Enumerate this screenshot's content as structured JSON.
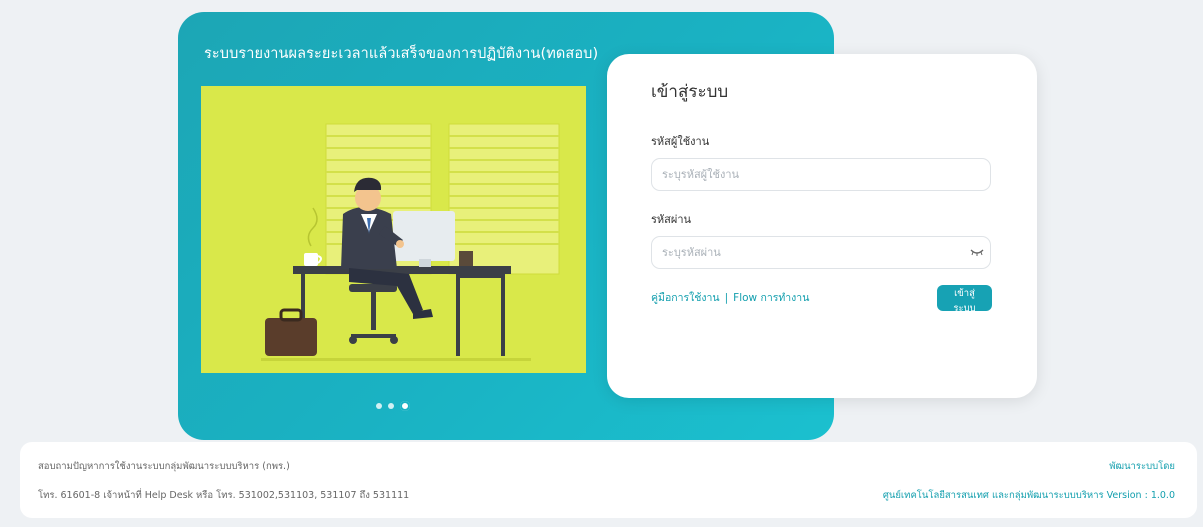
{
  "hero": {
    "title": "ระบบรายงานผลระยะเวลาแล้วเสร็จของการปฏิบัติงาน(ทดสอบ)",
    "carousel": {
      "slides": 3,
      "active_index": 3
    }
  },
  "login": {
    "title": "เข้าสู่ระบบ",
    "username_label": "รหัสผู้ใช้งาน",
    "username_placeholder": "ระบุรหัสผู้ใช้งาน",
    "password_label": "รหัสผ่าน",
    "password_placeholder": "ระบุรหัสผ่าน",
    "manual_link": "คู่มือการใช้งาน",
    "separator": "|",
    "flow_link": "Flow การทำงาน",
    "submit_label": "เข้าสู่ระบบ"
  },
  "footer": {
    "contact_title": "สอบถามปัญหาการใช้งานระบบกลุ่มพัฒนาระบบบริหาร (กพร.)",
    "contact_phone": "โทร. 61601-8 เจ้าหน้าที่ Help Desk หรือ โทร. 531002,531103, 531107 ถึง 531111",
    "developed_by": "พัฒนาระบบโดย",
    "developer_version": "ศูนย์เทคโนโลยีสารสนเทศ และกลุ่มพัฒนาระบบบริหาร Version : 1.0.0"
  },
  "colors": {
    "accent": "#17a2b4",
    "hero_bg": "#1ab2c3",
    "illustration_bg": "#d9e84a"
  }
}
